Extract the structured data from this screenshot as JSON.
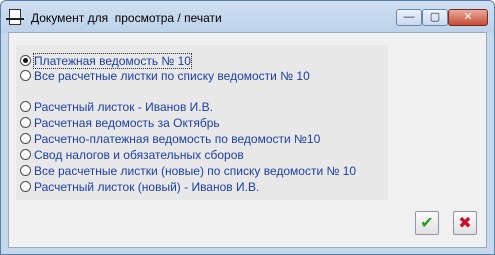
{
  "window": {
    "title": "Документ для  просмотра / печати",
    "controls": {
      "minimize": "—",
      "maximize": "▢",
      "close": "✕"
    }
  },
  "options": [
    {
      "label": "Платежная ведомость № 10",
      "checked": true
    },
    {
      "label": "Все расчетные листки по списку ведомости № 10",
      "checked": false
    },
    {
      "label": "Расчетный листок - Иванов И.В.",
      "checked": false
    },
    {
      "label": "Расчетная ведомость за Октябрь",
      "checked": false
    },
    {
      "label": "Расчетно-платежная ведомость по ведомости №10",
      "checked": false
    },
    {
      "label": "Свод налогов и обязательных сборов",
      "checked": false
    },
    {
      "label": "Все расчетные листки (новые) по списку ведомости № 10",
      "checked": false
    },
    {
      "label": "Расчетный листок (новый) - Иванов И.В.",
      "checked": false
    }
  ],
  "buttons": {
    "ok": "✔",
    "cancel": "✖"
  }
}
